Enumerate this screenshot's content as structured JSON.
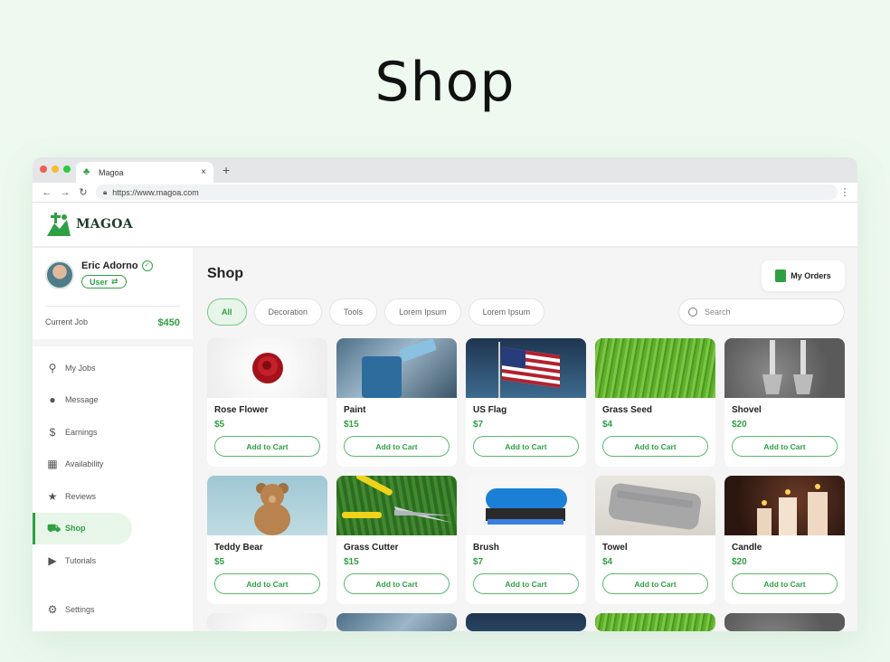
{
  "heading": "Shop",
  "browser": {
    "tab_title": "Magoa",
    "tab_close": "×",
    "new_tab": "+",
    "url": "https://www.magoa.com"
  },
  "app": {
    "logo": "MAGOA",
    "brand_color": "#2ea043"
  },
  "user": {
    "name": "Eric Adorno",
    "role": "User",
    "current_job_label": "Current Job",
    "current_job_amount": "$450"
  },
  "sidebar": {
    "items": [
      {
        "label": "My Jobs",
        "icon": "broom-icon"
      },
      {
        "label": "Message",
        "icon": "chat-icon"
      },
      {
        "label": "Earnings",
        "icon": "dollar-icon"
      },
      {
        "label": "Availability",
        "icon": "calendar-icon"
      },
      {
        "label": "Reviews",
        "icon": "star-icon"
      },
      {
        "label": "Shop",
        "icon": "cart-icon",
        "active": true
      },
      {
        "label": "Tutorials",
        "icon": "play-icon"
      }
    ],
    "settings_label": "Settings"
  },
  "main": {
    "title": "Shop",
    "orders_button": "My Orders",
    "filters": [
      "All",
      "Decoration",
      "Tools",
      "Lorem Ipsum",
      "Lorem Ipsum"
    ],
    "search_placeholder": "Search",
    "add_to_cart": "Add to Cart",
    "products": [
      {
        "name": "Rose Flower",
        "price": "$5"
      },
      {
        "name": "Paint",
        "price": "$15"
      },
      {
        "name": "US Flag",
        "price": "$7"
      },
      {
        "name": "Grass Seed",
        "price": "$4"
      },
      {
        "name": "Shovel",
        "price": "$20"
      },
      {
        "name": "Teddy Bear",
        "price": "$5"
      },
      {
        "name": "Grass Cutter",
        "price": "$15"
      },
      {
        "name": "Brush",
        "price": "$7"
      },
      {
        "name": "Towel",
        "price": "$4"
      },
      {
        "name": "Candle",
        "price": "$20"
      }
    ]
  }
}
